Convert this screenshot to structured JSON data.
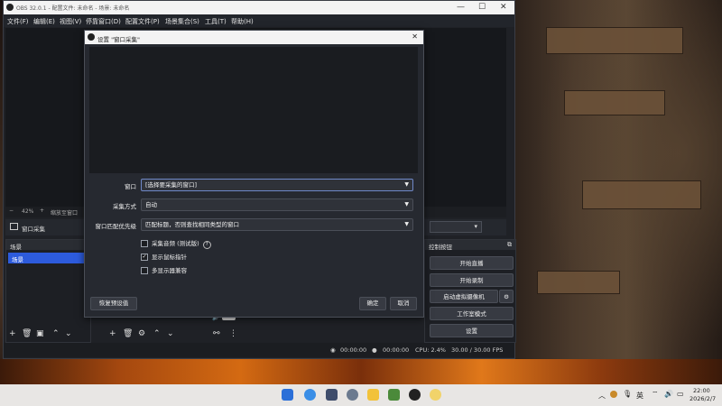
{
  "window": {
    "title": "OBS 32.0.1 - 配置文件: 未命名 - 场景: 未命名",
    "min": "—",
    "max": "☐",
    "close": "✕"
  },
  "menu": [
    "文件(F)",
    "编辑(E)",
    "视图(V)",
    "停靠窗口(D)",
    "配置文件(P)",
    "场景集合(S)",
    "工具(T)",
    "帮助(H)"
  ],
  "zoom": {
    "minus": "−",
    "level": "42%",
    "plus": "+",
    "label": "缩放至窗口"
  },
  "source_bar": {
    "name": "窗口采集",
    "gear": "⚙",
    "arrow": "▾"
  },
  "scenes": {
    "header": "场景",
    "items": [
      "场景"
    ]
  },
  "controls": {
    "header": "控制按钮",
    "buttons": [
      "开始直播",
      "开始录制",
      "启动虚拟摄像机",
      "工作室模式",
      "设置"
    ],
    "vcam_gear": "⚙"
  },
  "status": {
    "live_time": "00:00:00",
    "rec_time": "00:00:00",
    "cpu": "CPU: 2.4%",
    "fps": "30.00 / 30.00 FPS"
  },
  "dialog": {
    "title": "设置 \"窗口采集\"",
    "close": "✕",
    "fields": [
      {
        "label": "窗口",
        "value": "[选择要采集的窗口]"
      },
      {
        "label": "采集方式",
        "value": "自动"
      },
      {
        "label": "窗口匹配优先级",
        "value": "匹配标题，否则查找相同类型的窗口"
      }
    ],
    "checkboxes": [
      {
        "label": "采集音频 (测试版)",
        "checked": false,
        "help": "?"
      },
      {
        "label": "显示鼠标指针",
        "checked": true
      },
      {
        "label": "多显示器兼容",
        "checked": false
      }
    ],
    "defaults_button": "恢复预设值",
    "ok_button": "确定",
    "cancel_button": "取消"
  },
  "taskbar": {
    "ime": "英",
    "time": "22:00",
    "date": "2026/2/7",
    "chevron": "︿",
    "apps": [
      "start",
      "search",
      "edge",
      "store",
      "settings",
      "explorer",
      "pycharm",
      "obs",
      "bulb"
    ]
  }
}
